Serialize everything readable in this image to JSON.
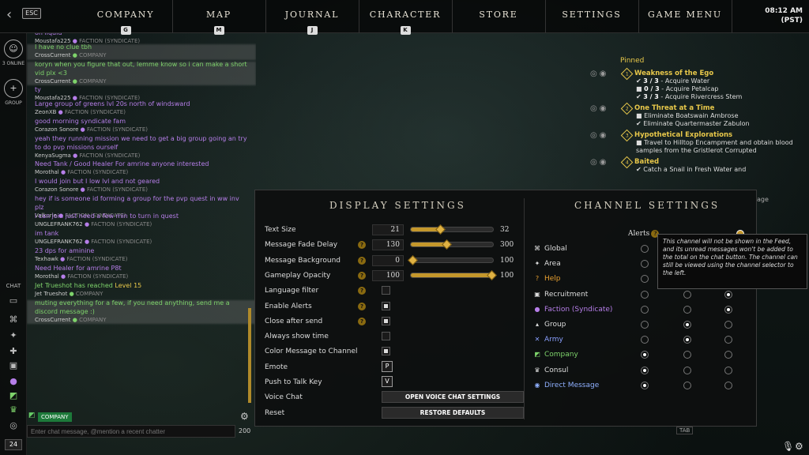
{
  "topbar": {
    "esc": "ESC",
    "nav": [
      {
        "label": "COMPANY",
        "key": "G"
      },
      {
        "label": "MAP",
        "key": "M"
      },
      {
        "label": "JOURNAL",
        "key": "J"
      },
      {
        "label": "CHARACTER",
        "key": "K"
      },
      {
        "label": "STORE",
        "key": ""
      },
      {
        "label": "SETTINGS",
        "key": ""
      },
      {
        "label": "GAME MENU",
        "key": ""
      }
    ],
    "time": "08:12 AM",
    "tz": "(PST)"
  },
  "leftcol": {
    "online": "3 ONLINE",
    "group": "GROUP",
    "chat": "CHAT",
    "level": "24"
  },
  "chat": {
    "messages": [
      {
        "text": "on liquid",
        "author": "Moustafa225",
        "faction": "FACTION (SYNDICATE)",
        "color": "purple"
      },
      {
        "text": "I have no clue tbh",
        "author": "CrossCurrent",
        "faction": "COMPANY",
        "color": "green"
      },
      {
        "text": "koryn when you figure that out, lemme know so i can make a short vid plx <3",
        "author": "CrossCurrent",
        "faction": "COMPANY",
        "color": "green"
      },
      {
        "text": "ty",
        "author": "Moustafa225",
        "faction": "FACTION (SYNDICATE)",
        "color": "purple"
      },
      {
        "text": "Large group of greens lvl 20s north of windsward",
        "author": "ZeonXB",
        "faction": "FACTION (SYNDICATE)",
        "color": "purple"
      },
      {
        "text": "good morning syndicate fam",
        "author": "Corazon Sonore",
        "faction": "FACTION (SYNDICATE)",
        "color": "purple"
      },
      {
        "text": "yeah they running mission we need to get a big group going an try to do pvp missions ourself",
        "author": "KenyaSugma",
        "faction": "FACTION (SYNDICATE)",
        "color": "purple"
      },
      {
        "text": "Need Tank / Good Healer For amrine anyone interested",
        "author": "Morothal",
        "faction": "FACTION (SYNDICATE)",
        "color": "purple"
      },
      {
        "text": "I would join but I low lvl and not geared",
        "author": "Corazon Sonore",
        "faction": "FACTION (SYNDICATE)",
        "color": "purple"
      },
      {
        "text": "hey if is someone id forming a group for the pvp quest in ww inv plz",
        "author": "Valkurie",
        "faction": "FACTION (SYNDICATE)",
        "color": "purple"
      },
      {
        "text": "i can join just need a few min to turn in quest",
        "author": "UNGLEFRANK762",
        "faction": "FACTION (SYNDICATE)",
        "color": "purple"
      },
      {
        "text": "im tank",
        "author": "UNGLEFRANK762",
        "faction": "FACTION (SYNDICATE)",
        "color": "purple"
      },
      {
        "text": "23 dps for aminine",
        "author": "Texhawk",
        "faction": "FACTION (SYNDICATE)",
        "color": "purple"
      },
      {
        "text": "Need Healer for amrine P8t",
        "author": "Morothal",
        "faction": "FACTION (SYNDICATE)",
        "color": "purple"
      },
      {
        "text": "Jet Trueshot has reached",
        "level": "Level 15",
        "author": "Jet Trueshot",
        "faction": "COMPANY",
        "color": "green"
      },
      {
        "text": "muting everything for a few, if you need anything, send me a discord message :)",
        "author": "CrossCurrent",
        "faction": "COMPANY",
        "color": "green"
      }
    ],
    "channel": "COMPANY",
    "placeholder": "Enter chat message, @mention a recent chatter",
    "count": "200"
  },
  "pinned": {
    "heading": "Pinned",
    "quests": [
      {
        "num": "1",
        "title": "Weakness of the Ego",
        "objectives": [
          {
            "done": true,
            "count": "3 / 3",
            "text": "Acquire Water"
          },
          {
            "done": false,
            "count": "0 / 3",
            "text": "Acquire Petalcap"
          },
          {
            "done": true,
            "count": "3 / 3",
            "text": "Acquire Rivercress Stem"
          }
        ]
      },
      {
        "num": "2",
        "title": "One Threat at a Time",
        "objectives": [
          {
            "done": false,
            "count": "",
            "text": "Eliminate Boatswain Ambrose"
          },
          {
            "done": true,
            "count": "",
            "text": "Eliminate Quartermaster Zabulon"
          }
        ]
      },
      {
        "num": "3",
        "title": "Hypothetical Explorations",
        "objectives": [
          {
            "done": false,
            "count": "",
            "text": "Travel to Hilltop Encampment and obtain blood samples from the Gristlerot Corrupted"
          }
        ]
      },
      {
        "num": "4",
        "title": "Baited",
        "objectives": [
          {
            "done": true,
            "count": "",
            "text": "Catch a Snail in Fresh Water and"
          }
        ]
      }
    ],
    "fragment": "age"
  },
  "display": {
    "title": "DISPLAY SETTINGS",
    "sliders": [
      {
        "label": "Text Size",
        "help": false,
        "value": "21",
        "max": "32",
        "level": 0.35
      },
      {
        "label": "Message Fade Delay",
        "help": true,
        "value": "130",
        "max": "300",
        "level": 0.43
      },
      {
        "label": "Message Background",
        "help": true,
        "value": "0",
        "max": "100",
        "level": 0.0
      },
      {
        "label": "Gameplay Opacity",
        "help": true,
        "value": "100",
        "max": "100",
        "level": 1.0
      }
    ],
    "toggles": [
      {
        "label": "Language filter",
        "help": true,
        "checked": false
      },
      {
        "label": "Enable Alerts",
        "help": true,
        "checked": true
      },
      {
        "label": "Close after send",
        "help": true,
        "checked": true
      },
      {
        "label": "Always show time",
        "help": false,
        "checked": false
      },
      {
        "label": "Color Message to Channel",
        "help": false,
        "checked": true
      }
    ],
    "keys": [
      {
        "label": "Emote",
        "key": "P"
      },
      {
        "label": "Push to Talk Key",
        "key": "V"
      }
    ],
    "voice_label": "Voice Chat",
    "voice_button": "OPEN VOICE CHAT SETTINGS",
    "reset_label": "Reset",
    "reset_button": "RESTORE DEFAULTS"
  },
  "channel": {
    "title": "CHANNEL SETTINGS",
    "alerts": "Alerts",
    "tooltip": "This channel will not be shown in the Feed, and its unread messages won't be added to the total on the chat button. The channel can still be viewed using the channel selector to the left.",
    "channels": [
      {
        "name": "Global",
        "color": "#dddddd",
        "icon": "globe-icon",
        "glyph": "⌘",
        "sel": [
          0,
          -1,
          -1
        ]
      },
      {
        "name": "Area",
        "color": "#dddddd",
        "icon": "area-icon",
        "glyph": "✦",
        "sel": [
          0,
          -1,
          -1
        ]
      },
      {
        "name": "Help",
        "color": "#e8a030",
        "icon": "help-icon",
        "glyph": "?",
        "sel": [
          0,
          -1,
          -1
        ]
      },
      {
        "name": "Recruitment",
        "color": "#dddddd",
        "icon": "recruitment-icon",
        "glyph": "▣",
        "sel": [
          0,
          0,
          1
        ]
      },
      {
        "name": "Faction (Syndicate)",
        "color": "#b67ee9",
        "icon": "faction-icon",
        "glyph": "●",
        "sel": [
          0,
          0,
          1
        ]
      },
      {
        "name": "Group",
        "color": "#dddddd",
        "icon": "group-icon",
        "glyph": "▴",
        "sel": [
          0,
          1,
          0
        ]
      },
      {
        "name": "Army",
        "color": "#8aa0ff",
        "icon": "army-icon",
        "glyph": "✕",
        "sel": [
          0,
          1,
          0
        ]
      },
      {
        "name": "Company",
        "color": "#7ed36b",
        "icon": "company-icon",
        "glyph": "◩",
        "sel": [
          1,
          0,
          0
        ]
      },
      {
        "name": "Consul",
        "color": "#dddddd",
        "icon": "consul-icon",
        "glyph": "♛",
        "sel": [
          1,
          0,
          0
        ]
      },
      {
        "name": "Direct Message",
        "color": "#8fb0ff",
        "icon": "direct-message-icon",
        "glyph": "◉",
        "sel": [
          1,
          0,
          0
        ]
      }
    ]
  },
  "misc": {
    "tab": "TAB"
  }
}
